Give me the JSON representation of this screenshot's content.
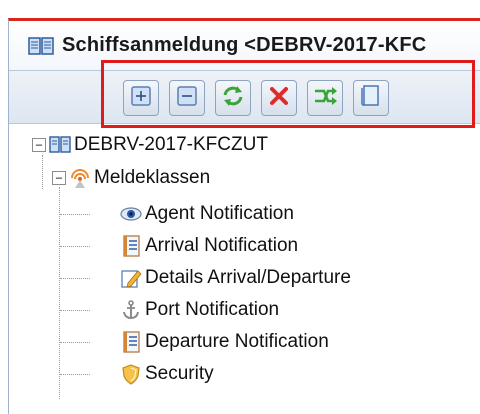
{
  "tab": {
    "title": "Schiffsanmeldung <DEBRV-2017-KFC",
    "icon": "book-icon",
    "accent_color": "#d9261c"
  },
  "toolbar": {
    "highlight_color": "#e01b1b",
    "buttons": [
      {
        "name": "expand-all-button",
        "icon": "plus-square-icon"
      },
      {
        "name": "collapse-all-button",
        "icon": "minus-square-icon"
      },
      {
        "name": "refresh-button",
        "icon": "refresh-arrows-icon"
      },
      {
        "name": "delete-button",
        "icon": "red-x-icon"
      },
      {
        "name": "transfer-button",
        "icon": "shuffle-arrows-icon"
      },
      {
        "name": "document-button",
        "icon": "document-icon"
      }
    ]
  },
  "tree": {
    "root": {
      "label": "DEBRV-2017-KFCZUT",
      "icon": "book-icon",
      "expander": "−"
    },
    "group": {
      "label": "Meldeklassen",
      "icon": "signal-icon",
      "expander": "−"
    },
    "items": [
      {
        "label": "Agent Notification",
        "icon": "eye-icon"
      },
      {
        "label": "Arrival Notification",
        "icon": "form-icon"
      },
      {
        "label": "Details Arrival/Departure",
        "icon": "edit-icon"
      },
      {
        "label": "Port Notification",
        "icon": "anchor-icon"
      },
      {
        "label": "Departure Notification",
        "icon": "form-icon"
      },
      {
        "label": "Security",
        "icon": "shield-icon"
      }
    ]
  }
}
